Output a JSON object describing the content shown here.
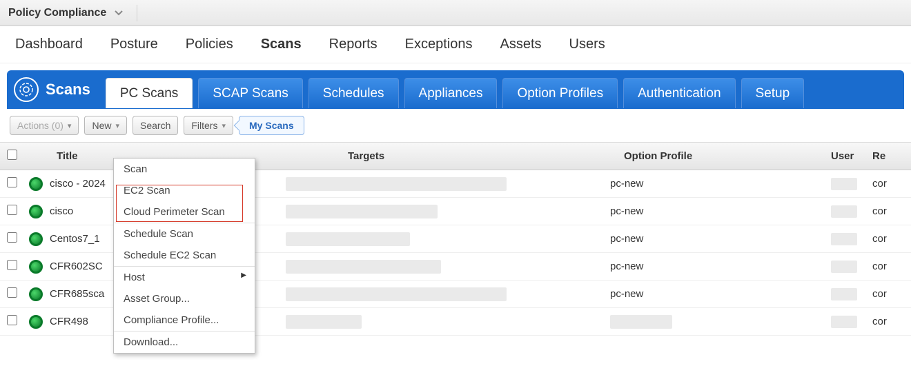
{
  "module": {
    "title": "Policy Compliance"
  },
  "mainNav": [
    {
      "label": "Dashboard",
      "active": false
    },
    {
      "label": "Posture",
      "active": false
    },
    {
      "label": "Policies",
      "active": false
    },
    {
      "label": "Scans",
      "active": true
    },
    {
      "label": "Reports",
      "active": false
    },
    {
      "label": "Exceptions",
      "active": false
    },
    {
      "label": "Assets",
      "active": false
    },
    {
      "label": "Users",
      "active": false
    }
  ],
  "blueBar": {
    "header": "Scans",
    "tabs": [
      {
        "label": "PC Scans",
        "active": true
      },
      {
        "label": "SCAP Scans",
        "active": false
      },
      {
        "label": "Schedules",
        "active": false
      },
      {
        "label": "Appliances",
        "active": false
      },
      {
        "label": "Option Profiles",
        "active": false
      },
      {
        "label": "Authentication",
        "active": false
      },
      {
        "label": "Setup",
        "active": false
      }
    ]
  },
  "toolbar": {
    "actions": "Actions (0)",
    "new": "New",
    "search": "Search",
    "filters": "Filters",
    "myScans": "My Scans"
  },
  "columns": {
    "title": "Title",
    "targets": "Targets",
    "option": "Option Profile",
    "user": "User",
    "ref": "Re"
  },
  "rows": [
    {
      "title": "cisco - 2024",
      "option": "pc-new",
      "ref": "cor",
      "targetsW": 320
    },
    {
      "title": "cisco",
      "option": "pc-new",
      "ref": "cor",
      "targetsW": 220
    },
    {
      "title": "Centos7_1",
      "option": "pc-new",
      "ref": "cor",
      "targetsW": 180
    },
    {
      "title": "CFR602SC",
      "option": "pc-new",
      "ref": "cor",
      "targetsW": 225
    },
    {
      "title": "CFR685sca",
      "option": "pc-new",
      "ref": "cor",
      "targetsW": 320
    },
    {
      "title": "CFR498",
      "option": "",
      "ref": "cor",
      "targetsW": 110
    }
  ],
  "dropdown": {
    "items": [
      {
        "label": "Scan",
        "sep": false,
        "sub": false
      },
      {
        "label": "EC2 Scan",
        "sep": false,
        "sub": false
      },
      {
        "label": "Cloud Perimeter Scan",
        "sep": false,
        "sub": false
      },
      {
        "label": "Schedule Scan",
        "sep": true,
        "sub": false
      },
      {
        "label": "Schedule EC2 Scan",
        "sep": false,
        "sub": false
      },
      {
        "label": "Host",
        "sep": true,
        "sub": true
      },
      {
        "label": "Asset Group...",
        "sep": false,
        "sub": false
      },
      {
        "label": "Compliance Profile...",
        "sep": false,
        "sub": false
      },
      {
        "label": "Download...",
        "sep": true,
        "sub": false
      }
    ]
  }
}
